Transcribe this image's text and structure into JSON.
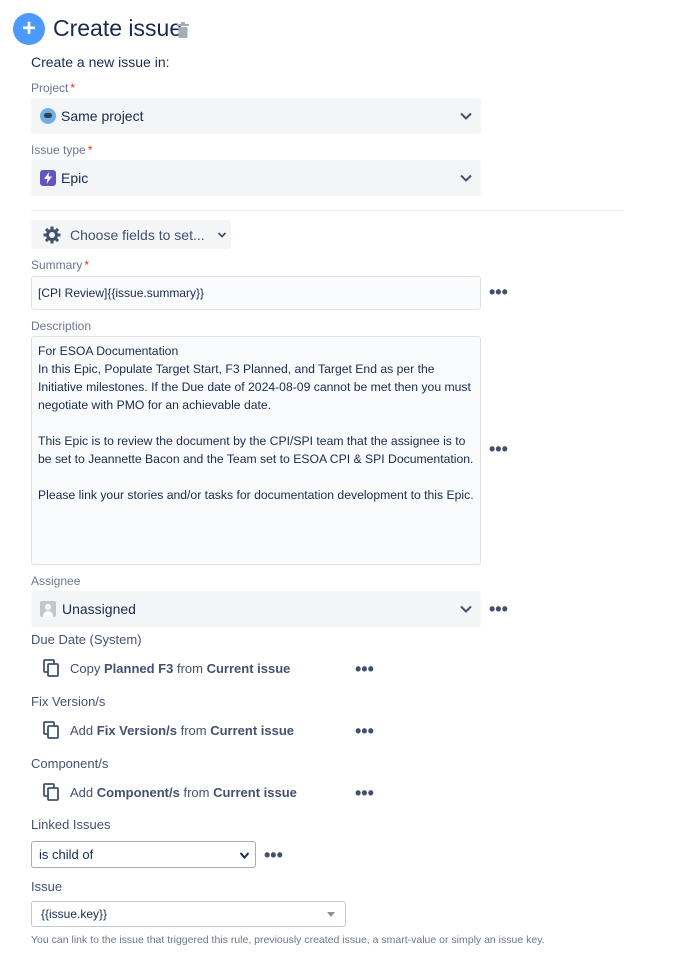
{
  "header": {
    "title": "Create issue",
    "add_symbol": "+"
  },
  "intro": "Create a new issue in:",
  "project": {
    "label": "Project",
    "required_mark": "*",
    "value": "Same project"
  },
  "issue_type": {
    "label": "Issue type",
    "required_mark": "*",
    "value": "Epic"
  },
  "choose_fields": {
    "label": "Choose fields to set..."
  },
  "summary": {
    "label": "Summary",
    "required_mark": "*",
    "value": "[CPI Review]{{issue.summary}}"
  },
  "description": {
    "label": "Description",
    "value": "For ESOA Documentation\nIn this Epic, Populate Target Start, F3 Planned, and Target End as per the Initiative milestones. If the Due date of 2024-08-09 cannot be met then you must negotiate with PMO for an achievable date.\n\nThis Epic is to review the document by the CPI/SPI team that the assignee is to be set to Jeannette Bacon and the Team set to ESOA CPI & SPI Documentation.\n\nPlease link your stories and/or tasks for documentation development to this Epic."
  },
  "assignee": {
    "label": "Assignee",
    "value": "Unassigned"
  },
  "more_symbol": "•••",
  "due_date": {
    "label": "Due Date (System)",
    "verb": "Copy",
    "field": "Planned F3",
    "from_word": "from",
    "source": "Current issue"
  },
  "fix_version": {
    "label": "Fix Version/s",
    "verb": "Add",
    "field": "Fix Version/s",
    "from_word": "from",
    "source": "Current issue"
  },
  "component": {
    "label": "Component/s",
    "verb": "Add",
    "field": "Component/s",
    "from_word": "from",
    "source": "Current issue"
  },
  "linked_issues": {
    "label": "Linked Issues",
    "value": "is child of"
  },
  "issue": {
    "label": "Issue",
    "value": "{{issue.key}}",
    "hint": "You can link to the issue that triggered this rule, previously created issue, a smart-value or simply an issue key."
  },
  "colors": {
    "accent": "#4c9aff",
    "epic": "#6554c0",
    "required": "#de350b",
    "text": "#172b4d",
    "muted": "#6b778c"
  }
}
